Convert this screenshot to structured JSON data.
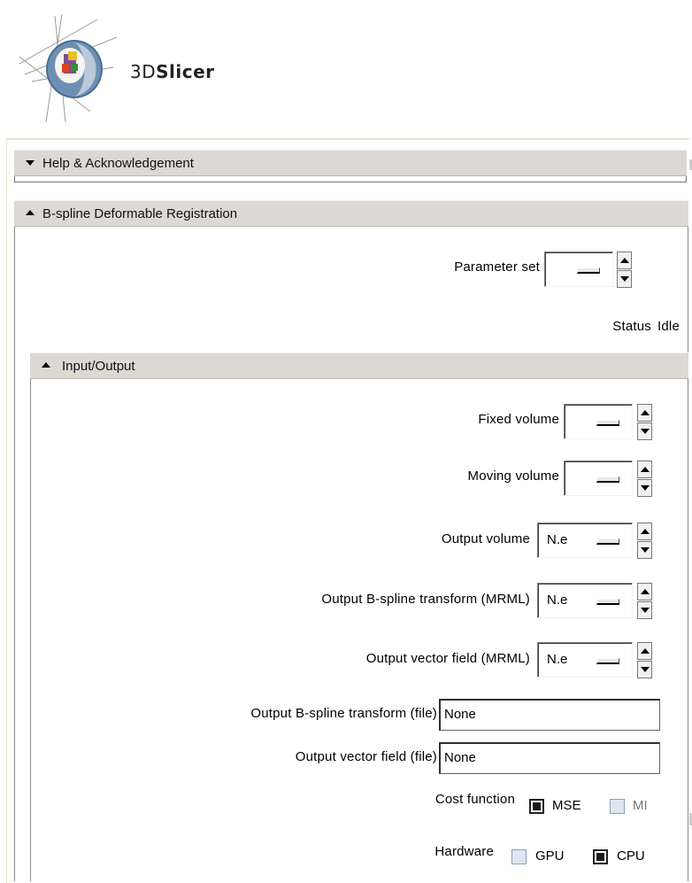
{
  "app": {
    "logo_text_light": "3D",
    "logo_text_bold": "Slicer"
  },
  "sections": {
    "help": {
      "title": "Help & Acknowledgement"
    },
    "bspline": {
      "title": "B-spline Deformable Registration",
      "parameter_set_label": "Parameter set",
      "status_label": "Status",
      "status_value": "Idle"
    },
    "io": {
      "title": "Input/Output",
      "fixed_volume_label": "Fixed volume",
      "moving_volume_label": "Moving volume",
      "output_volume_label": "Output volume",
      "output_volume_value": "N.e",
      "output_bspline_mrml_label": "Output B-spline transform (MRML)",
      "output_bspline_mrml_value": "N.e",
      "output_vector_mrml_label": "Output vector field (MRML)",
      "output_vector_mrml_value": "N.e",
      "output_bspline_file_label": "Output B-spline transform (file)",
      "output_bspline_file_value": "None",
      "output_vector_file_label": "Output vector field (file)",
      "output_vector_file_value": "None",
      "cost_function_label": "Cost function",
      "cost_mse": "MSE",
      "cost_mi": "MI",
      "hardware_label": "Hardware",
      "hw_gpu": "GPU",
      "hw_cpu": "CPU"
    }
  }
}
